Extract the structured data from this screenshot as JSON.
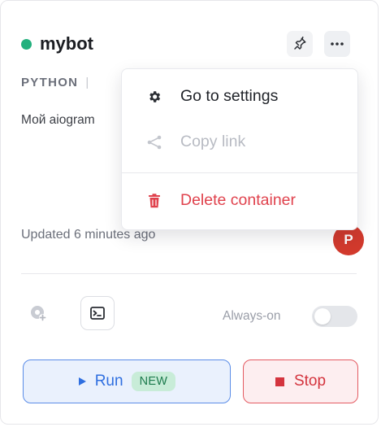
{
  "colors": {
    "status": "#22b07d",
    "avatar": "#d23a2d",
    "run": "#2f6fe0",
    "stop": "#d4343e",
    "delete": "#e0424d"
  },
  "header": {
    "title": "mybot",
    "status_icon": "green-dot-icon",
    "pin_icon": "pin-icon",
    "more_icon": "ellipsis-icon"
  },
  "meta": {
    "language": "PYTHON",
    "separator": "|"
  },
  "description": "Мой aiogram",
  "footer": {
    "updated": "Updated 6 minutes ago",
    "avatar_initial": "P"
  },
  "tools": {
    "add_image_icon": "image-add-icon",
    "console_icon": "terminal-icon",
    "always_on_label": "Always-on",
    "always_on": false
  },
  "actions": {
    "run_label": "Run",
    "run_badge": "NEW",
    "stop_label": "Stop"
  },
  "menu": {
    "items": [
      {
        "label": "Go to settings",
        "icon": "gear-icon",
        "enabled": true
      },
      {
        "label": "Copy link",
        "icon": "share-icon",
        "enabled": false
      },
      {
        "label": "Delete container",
        "icon": "trash-icon",
        "enabled": true
      }
    ]
  }
}
